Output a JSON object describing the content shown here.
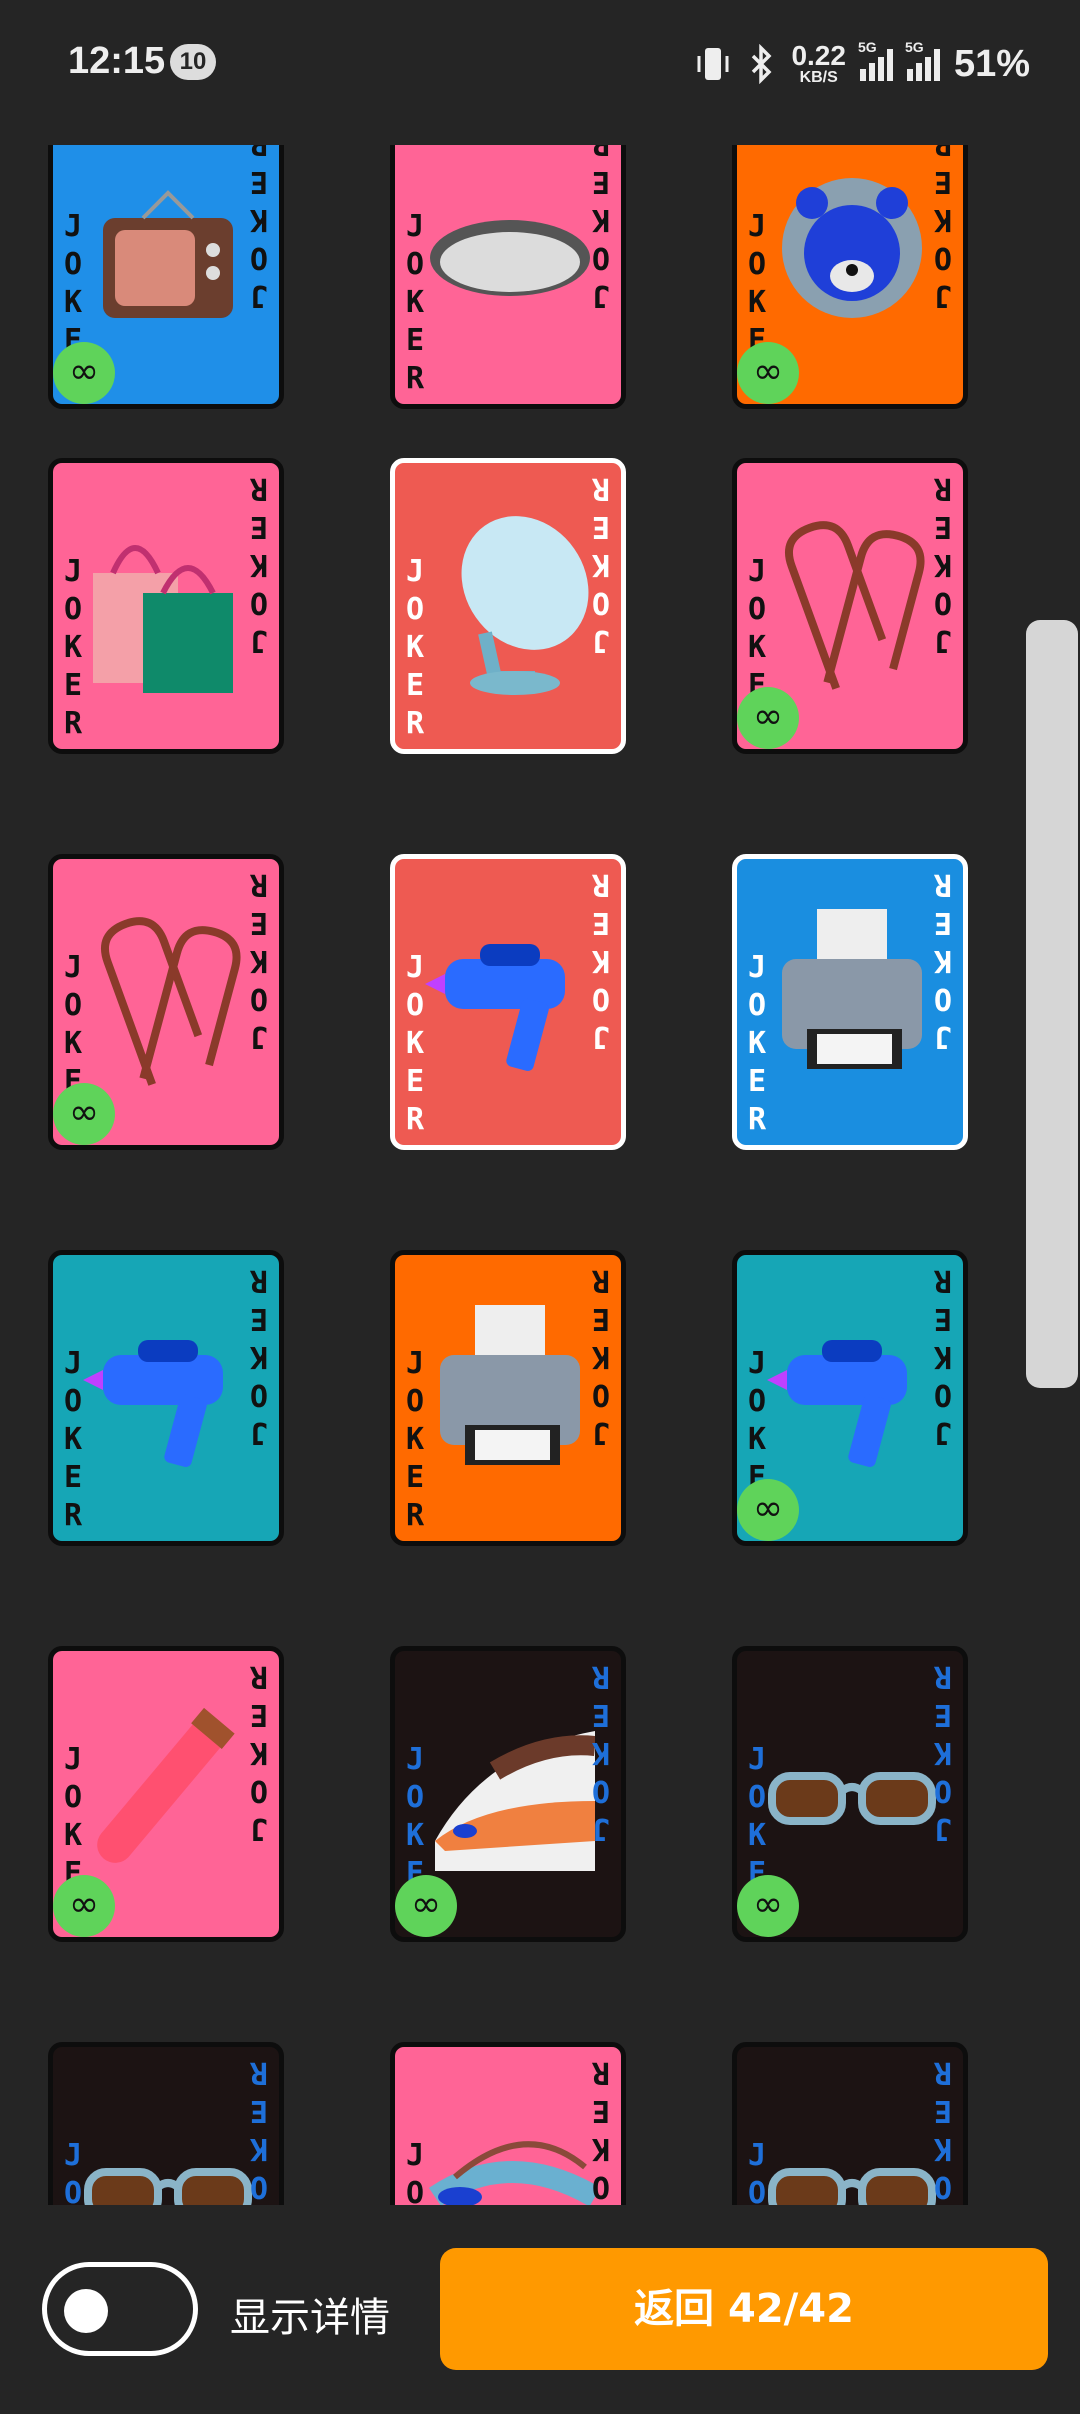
{
  "status_bar": {
    "time": "12:15",
    "notification_count": "10",
    "net_speed_value": "0.22",
    "net_speed_unit": "KB/S",
    "sim1_label": "5G",
    "sim2_label": "5G",
    "battery": "51%"
  },
  "card_word": "JOKER",
  "cards": [
    {
      "bg": "#1f8fe8",
      "text_color": "#111",
      "selected": false,
      "infinite": true,
      "icon": "television-icon"
    },
    {
      "bg": "#ff6496",
      "text_color": "#111",
      "selected": false,
      "infinite": false,
      "icon": "hole-icon"
    },
    {
      "bg": "#ff6a00",
      "text_color": "#111",
      "selected": false,
      "infinite": true,
      "icon": "bear-icon"
    },
    {
      "bg": "#ff6496",
      "text_color": "#111",
      "selected": false,
      "infinite": false,
      "icon": "shopping-bags-icon"
    },
    {
      "bg": "#ee5a52",
      "text_color": "#fff",
      "selected": true,
      "infinite": false,
      "icon": "satellite-dish-icon"
    },
    {
      "bg": "#ff6496",
      "text_color": "#111",
      "selected": false,
      "infinite": true,
      "icon": "paperclips-icon"
    },
    {
      "bg": "#ff6496",
      "text_color": "#111",
      "selected": false,
      "infinite": true,
      "icon": "paperclips-icon"
    },
    {
      "bg": "#ee5a52",
      "text_color": "#fff",
      "selected": true,
      "infinite": false,
      "icon": "water-gun-icon"
    },
    {
      "bg": "#1a8ee0",
      "text_color": "#fff",
      "selected": true,
      "infinite": false,
      "icon": "printer-icon"
    },
    {
      "bg": "#16a6b6",
      "text_color": "#111",
      "selected": false,
      "infinite": false,
      "icon": "water-gun-icon"
    },
    {
      "bg": "#ff6a00",
      "text_color": "#111",
      "selected": false,
      "infinite": false,
      "icon": "printer-icon"
    },
    {
      "bg": "#16a6b6",
      "text_color": "#111",
      "selected": false,
      "infinite": true,
      "icon": "water-gun-icon"
    },
    {
      "bg": "#ff6496",
      "text_color": "#111",
      "selected": false,
      "infinite": true,
      "icon": "test-tube-icon"
    },
    {
      "bg": "#1c1313",
      "text_color": "#1e6fd9",
      "selected": false,
      "infinite": true,
      "icon": "bullet-train-icon"
    },
    {
      "bg": "#1c1313",
      "text_color": "#1e6fd9",
      "selected": false,
      "infinite": true,
      "icon": "sunglasses-icon"
    },
    {
      "bg": "#1c1313",
      "text_color": "#1e6fd9",
      "selected": false,
      "infinite": false,
      "icon": "sunglasses-icon"
    },
    {
      "bg": "#ff6496",
      "text_color": "#111",
      "selected": false,
      "infinite": false,
      "icon": "goggles-icon"
    },
    {
      "bg": "#1c1313",
      "text_color": "#1e6fd9",
      "selected": false,
      "infinite": false,
      "icon": "sunglasses-icon"
    }
  ],
  "infinite_symbol": "∞",
  "bottom": {
    "toggle_label": "显示详情",
    "toggle_on": false,
    "back_button": "返回 42/42"
  }
}
